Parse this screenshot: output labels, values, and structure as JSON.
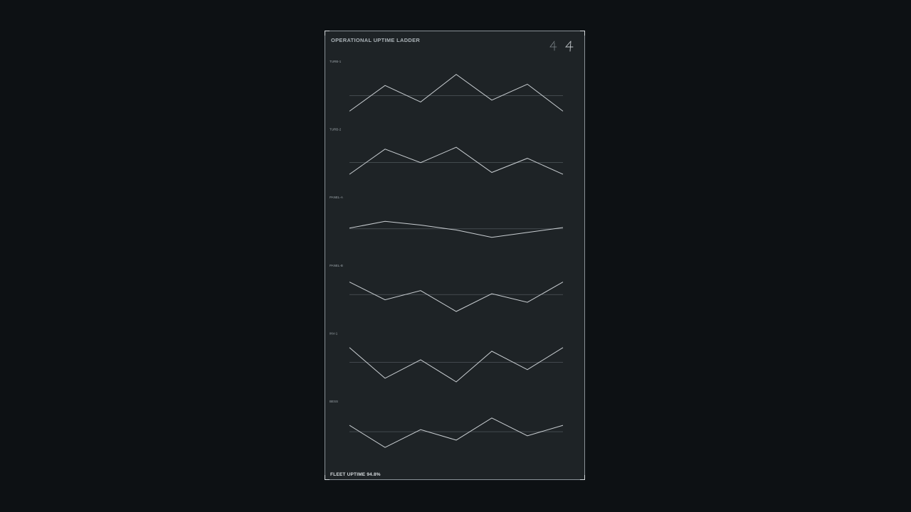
{
  "title": "OPERATIONAL UPTIME LADDER",
  "footer": "FLEET UPTIME 94.8%",
  "colors": {
    "background": "#0d1114",
    "panel": "#1e2326",
    "line": "#c9ced2",
    "reference": "#5a6166"
  },
  "chart_data": {
    "type": "line",
    "layout": "small-multiples",
    "title": "OPERATIONAL UPTIME LADDER",
    "xlabel": "",
    "ylabel": "",
    "x": [
      1,
      2,
      3,
      4,
      5,
      6,
      7
    ],
    "ylim": [
      -4,
      4
    ],
    "grid": false,
    "reference_line": "series mean",
    "series": [
      {
        "name": "TURB-1",
        "values": [
          -3.0,
          1.2,
          -1.5,
          3.0,
          -1.2,
          1.4,
          -3.0
        ]
      },
      {
        "name": "TURB-2",
        "values": [
          -2.2,
          1.9,
          -0.3,
          2.2,
          -1.9,
          0.4,
          -2.2
        ]
      },
      {
        "name": "PANEL-A",
        "values": [
          0.1,
          1.2,
          0.6,
          -0.2,
          -1.4,
          -0.6,
          0.2
        ]
      },
      {
        "name": "PANEL-B",
        "values": [
          2.4,
          -0.5,
          1.0,
          -2.4,
          0.5,
          -0.9,
          2.4
        ]
      },
      {
        "name": "INV-1",
        "values": [
          2.8,
          -2.2,
          0.8,
          -2.8,
          2.2,
          -0.8,
          2.8
        ]
      },
      {
        "name": "BESS",
        "values": [
          1.2,
          -2.4,
          0.5,
          -1.2,
          2.4,
          -0.5,
          1.2
        ]
      }
    ]
  }
}
